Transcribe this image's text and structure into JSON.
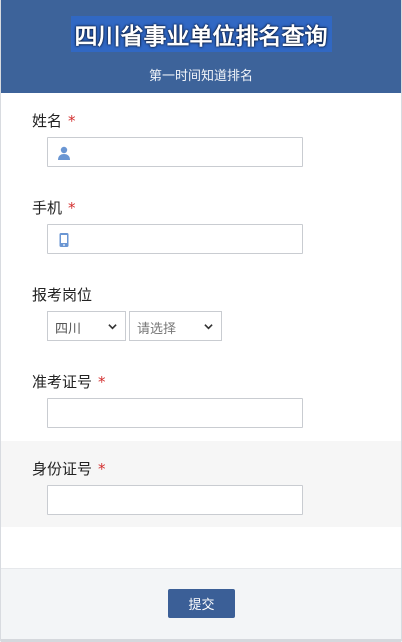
{
  "header": {
    "title": "四川省事业单位排名查询",
    "subtitle": "第一时间知道排名"
  },
  "form": {
    "name": {
      "label": "姓名",
      "required": "*",
      "value": ""
    },
    "phone": {
      "label": "手机",
      "required": "*",
      "value": ""
    },
    "position": {
      "label": "报考岗位",
      "province_value": "四川",
      "city_value": "请选择"
    },
    "exam_id": {
      "label": "准考证号",
      "required": "*",
      "value": ""
    },
    "id_card": {
      "label": "身份证号",
      "required": "*",
      "value": ""
    }
  },
  "footer": {
    "submit_label": "提交"
  },
  "icons": {
    "name": "user-icon",
    "phone": "mobile-phone-icon",
    "select": "chevron-down-icon"
  },
  "colors": {
    "header_bg": "#3d639a",
    "button_bg": "#3b5f97",
    "required": "#d32f2f",
    "icon": "#6a96d3"
  }
}
